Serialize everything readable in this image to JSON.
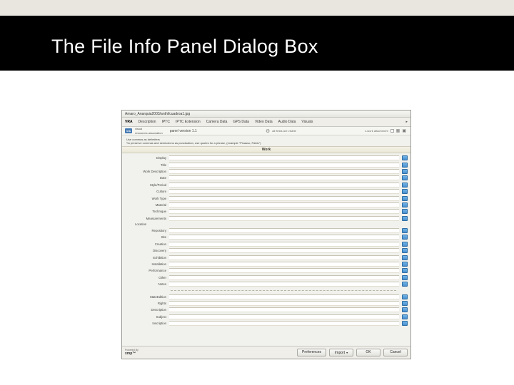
{
  "accent": {},
  "slide": {
    "title": "The File Info Panel Dialog Box"
  },
  "dialog": {
    "title": "Amaro_Anarquia2003/anthl/cuadroa1.jpg",
    "tabs": [
      "VRA",
      "Description",
      "IPTC",
      "IPTC Extension",
      "Camera Data",
      "GPS Data",
      "Video Data",
      "Audio Data",
      "Visuals"
    ],
    "active_tab_index": 0,
    "tabs_more_glyph": "▸",
    "breadcrumb": {
      "brand": "vra",
      "brand_sub_top": "visual",
      "brand_sub_bottom": "resources association",
      "panel_text": "panel version 1.1",
      "fields_status": "all fields are visible",
      "attachment_label": "x-work attachment",
      "check_icon": "✔"
    },
    "hint_line1": "Use commas as delimiters",
    "hint_line2": "*to preserve commas and semicolons as punctuation, use quotes for a phrase, (example \"Picasso, Pablo\")",
    "section_work": "Work",
    "rows_pre_location": [
      {
        "label": "Display",
        "indent": false
      },
      {
        "label": "Title",
        "indent": false
      },
      {
        "label": "Work Description",
        "indent": false
      },
      {
        "label": "Date",
        "indent": false
      },
      {
        "label": "Style/Period",
        "indent": false
      },
      {
        "label": "Culture",
        "indent": false
      },
      {
        "label": "Work Type",
        "indent": false
      },
      {
        "label": "Material",
        "indent": false
      },
      {
        "label": "Technique",
        "indent": false
      },
      {
        "label": "Measurements",
        "indent": false
      }
    ],
    "location_group_label": "Location",
    "rows_location": [
      {
        "label": "Repository",
        "indent": true
      },
      {
        "label": "Site",
        "indent": true
      },
      {
        "label": "Creation",
        "indent": true
      },
      {
        "label": "Discovery",
        "indent": true
      },
      {
        "label": "Exhibition",
        "indent": true
      },
      {
        "label": "Installation",
        "indent": true
      },
      {
        "label": "Performance",
        "indent": true
      },
      {
        "label": "Other",
        "indent": true
      },
      {
        "label": "Notes",
        "indent": true
      }
    ],
    "rows_post": [
      {
        "label": "StateEdition",
        "indent": false
      },
      {
        "label": "Rights",
        "indent": false
      },
      {
        "label": "Description",
        "indent": false
      },
      {
        "label": "Subject",
        "indent": false
      },
      {
        "label": "Inscription",
        "indent": false
      }
    ],
    "footer": {
      "powered_top": "Powered By",
      "brand": "xmp™",
      "buttons": {
        "preferences": "Preferences",
        "import": "Import",
        "import_arrow": "▾",
        "ok": "OK",
        "cancel": "Cancel"
      }
    }
  }
}
